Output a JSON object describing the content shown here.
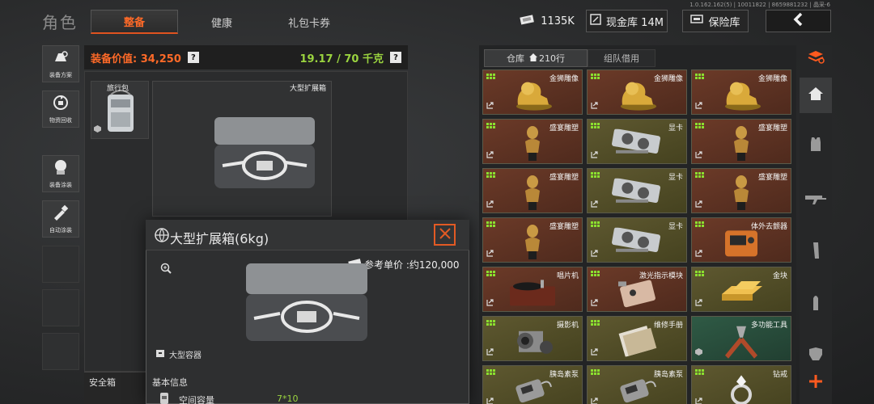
{
  "header": {
    "title": "角色",
    "tabs": [
      {
        "label": "整备",
        "active": true
      },
      {
        "label": "健康",
        "active": false
      },
      {
        "label": "礼包卡券",
        "active": false
      }
    ],
    "version": "1.0.162.162(5) | 10011822 | 8659881232 | 晶采-6",
    "coins": "1135K",
    "cash_vault": "现金库 14M",
    "safe_vault": "保险库"
  },
  "sidebar": {
    "items": [
      {
        "label": "装备方案",
        "icon": "gear-plan-icon"
      },
      {
        "label": "物资回收",
        "icon": "recycle-icon"
      },
      {
        "label": "装备涂装",
        "icon": "paint-icon"
      },
      {
        "label": "自动涂装",
        "icon": "auto-paint-icon"
      }
    ]
  },
  "equipment": {
    "value_label": "装备价值: 34,250",
    "weight": "19.17 / 70 千克",
    "help": "?",
    "backpack_name": "旅行包",
    "box_name": "大型扩展箱",
    "safe_box_label": "安全箱"
  },
  "popup": {
    "title": "大型扩展箱(6kg)",
    "ref_price": "参考单价 :约120,000",
    "container_type": "大型容器",
    "basic_info": "基本信息",
    "capacity_label": "空间容量",
    "capacity_value": "7*10"
  },
  "warehouse": {
    "tabs": [
      {
        "label": "仓库",
        "count": "210行"
      },
      {
        "label": "组队借用"
      }
    ],
    "items": [
      {
        "name": "金狮雕像",
        "color": "brown",
        "icon": "lion-statue-icon"
      },
      {
        "name": "金狮雕像",
        "color": "brown",
        "icon": "lion-statue-icon"
      },
      {
        "name": "金狮雕像",
        "color": "brown",
        "icon": "lion-statue-icon"
      },
      {
        "name": "盛宴雕塑",
        "color": "brown",
        "icon": "bust-sculpture-icon"
      },
      {
        "name": "显卡",
        "color": "olive",
        "icon": "graphics-card-icon"
      },
      {
        "name": "盛宴雕塑",
        "color": "brown",
        "icon": "bust-sculpture-icon"
      },
      {
        "name": "盛宴雕塑",
        "color": "brown",
        "icon": "bust-sculpture-icon"
      },
      {
        "name": "显卡",
        "color": "olive",
        "icon": "graphics-card-icon"
      },
      {
        "name": "盛宴雕塑",
        "color": "brown",
        "icon": "bust-sculpture-icon"
      },
      {
        "name": "盛宴雕塑",
        "color": "brown",
        "icon": "bust-sculpture-icon"
      },
      {
        "name": "显卡",
        "color": "olive",
        "icon": "graphics-card-icon"
      },
      {
        "name": "体外去颤器",
        "color": "brown",
        "icon": "defibrillator-icon"
      },
      {
        "name": "唱片机",
        "color": "brown",
        "icon": "record-player-icon"
      },
      {
        "name": "激光指示模块",
        "color": "brown",
        "icon": "laser-module-icon"
      },
      {
        "name": "金块",
        "color": "olive",
        "icon": "gold-bar-icon"
      },
      {
        "name": "摄影机",
        "color": "olive",
        "icon": "camera-icon"
      },
      {
        "name": "维修手册",
        "color": "olive",
        "icon": "manual-icon"
      },
      {
        "name": "多功能工具",
        "color": "teal",
        "icon": "multitool-icon"
      },
      {
        "name": "胰岛素泵",
        "color": "olive",
        "icon": "insulin-pump-icon"
      },
      {
        "name": "胰岛素泵",
        "color": "olive",
        "icon": "insulin-pump-icon"
      },
      {
        "name": "钻戒",
        "color": "olive",
        "icon": "diamond-ring-icon"
      }
    ]
  },
  "right_nav": [
    "stack-icon",
    "home-icon",
    "vest-icon",
    "rifle-icon",
    "magazine-icon",
    "ammo-icon",
    "armor-icon",
    "plus-icon"
  ],
  "colors": {
    "accent": "#ff6a28",
    "green": "#9ad33f",
    "brown_cell": "#5a301f",
    "olive_cell": "#514c27"
  }
}
